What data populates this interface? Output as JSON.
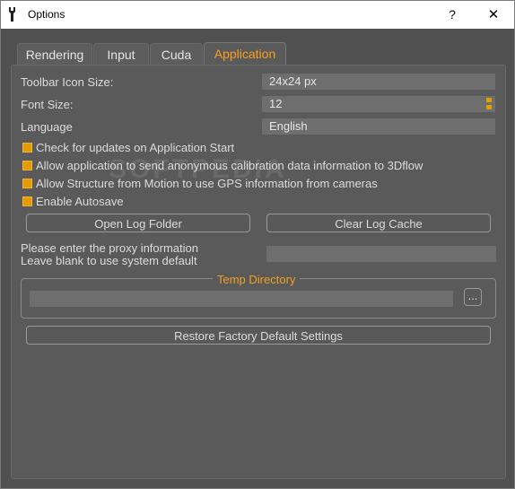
{
  "window": {
    "title": "Options",
    "help_label": "?",
    "close_label": "✕"
  },
  "tabs": [
    {
      "label": "Rendering",
      "active": false
    },
    {
      "label": "Input",
      "active": false
    },
    {
      "label": "Cuda",
      "active": false
    },
    {
      "label": "Application",
      "active": true
    }
  ],
  "settings": {
    "toolbar_icon_size": {
      "label": "Toolbar Icon Size:",
      "value": "24x24 px"
    },
    "font_size": {
      "label": "Font Size:",
      "value": "12"
    },
    "language": {
      "label": "Language",
      "value": "English"
    }
  },
  "checkboxes": [
    {
      "label": "Check for updates on Application Start",
      "checked": true
    },
    {
      "label": "Allow application to send anonymous calibration data information to 3Dflow",
      "checked": true
    },
    {
      "label": "Allow Structure from Motion to use GPS information from cameras",
      "checked": true
    },
    {
      "label": "Enable Autosave",
      "checked": true
    }
  ],
  "buttons": {
    "open_log_folder": "Open Log Folder",
    "clear_log_cache": "Clear Log Cache",
    "browse": "...",
    "restore_defaults": "Restore Factory Default Settings"
  },
  "proxy": {
    "line1": "Please enter the proxy information",
    "line2": "Leave blank to use system default",
    "value": ""
  },
  "temp_directory": {
    "title": "Temp Directory",
    "value": ""
  },
  "watermark": "SOFTPEDIA",
  "colors": {
    "accent": "#ff9d1a",
    "checkbox": "#e39b00",
    "background": "#505050",
    "panel": "#5a5a5a"
  }
}
